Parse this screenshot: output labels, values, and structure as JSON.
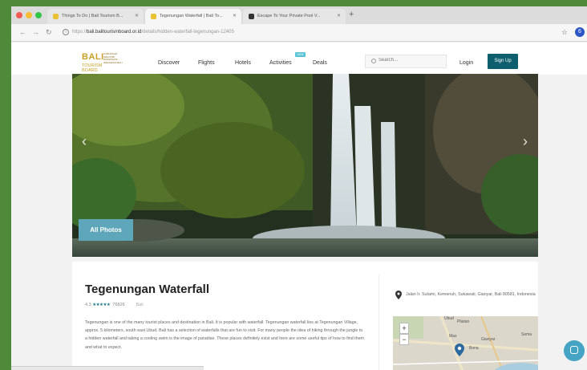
{
  "browser": {
    "tabs": [
      {
        "title": "Things To Do | Bali Tourism B...",
        "favicon_color": "#e9c233"
      },
      {
        "title": "Tegenungan Waterfall | Bali To...",
        "favicon_color": "#e9c233"
      },
      {
        "title": "Escape To Your Private Pool V...",
        "favicon_color": "#333333"
      }
    ],
    "new_tab": "+",
    "url_prefix": "https://",
    "url_domain": "bali.balitourismboard.or.id",
    "url_path": "/details/hidden-waterfall-tegenungan-12405",
    "profile_initial": "6"
  },
  "site": {
    "logo": {
      "line1": "BALI",
      "line2": "TOURISM BOARD",
      "sub": "GABUNGAN INDUSTRI PARIWISATA INDONESIA BALI"
    },
    "nav": [
      "Discover",
      "Flights",
      "Hotels",
      "Activities",
      "Deals"
    ],
    "new_badge": "NEW",
    "search_placeholder": "Search...",
    "login_label": "Login",
    "signup_label": "Sign Up"
  },
  "hero": {
    "prev": "‹",
    "next": "›",
    "all_photos_label": "All Photos"
  },
  "listing": {
    "title": "Tegenungan Waterfall",
    "rating": "4.3",
    "stars": "★★★★★",
    "reviews": "76826",
    "location": "Bali",
    "description": "Tegenungan is one of the many tourist places and destination in Bali. It is popular with waterfall. Tegenungan waterfall lies at Tegenungan Village, approx. 5 kilometers, south east Ubud. Bali has a selection of waterfalls that are fun to visit. For many people the idea of hiking through the jungle to a hidden waterfall and taking a cooling swim is the image of paradise. These places definitely exist and here are some useful tips of how to find them and what to expect.",
    "address": "Jalan Ir. Sutami, Kemenuh, Sukawati, Gianyar, Bali 80581, Indonesia",
    "map": {
      "zoom_in": "+",
      "zoom_out": "−",
      "labels": [
        "Ubud",
        "Pliatan",
        "Gianyar",
        "Mas",
        "Bona",
        "Sema"
      ]
    }
  },
  "colors": {
    "brand": "#0e5f6e",
    "accent": "#5ea6b9",
    "logo_gold": "#c9a227",
    "frame": "#4e8a3a"
  }
}
